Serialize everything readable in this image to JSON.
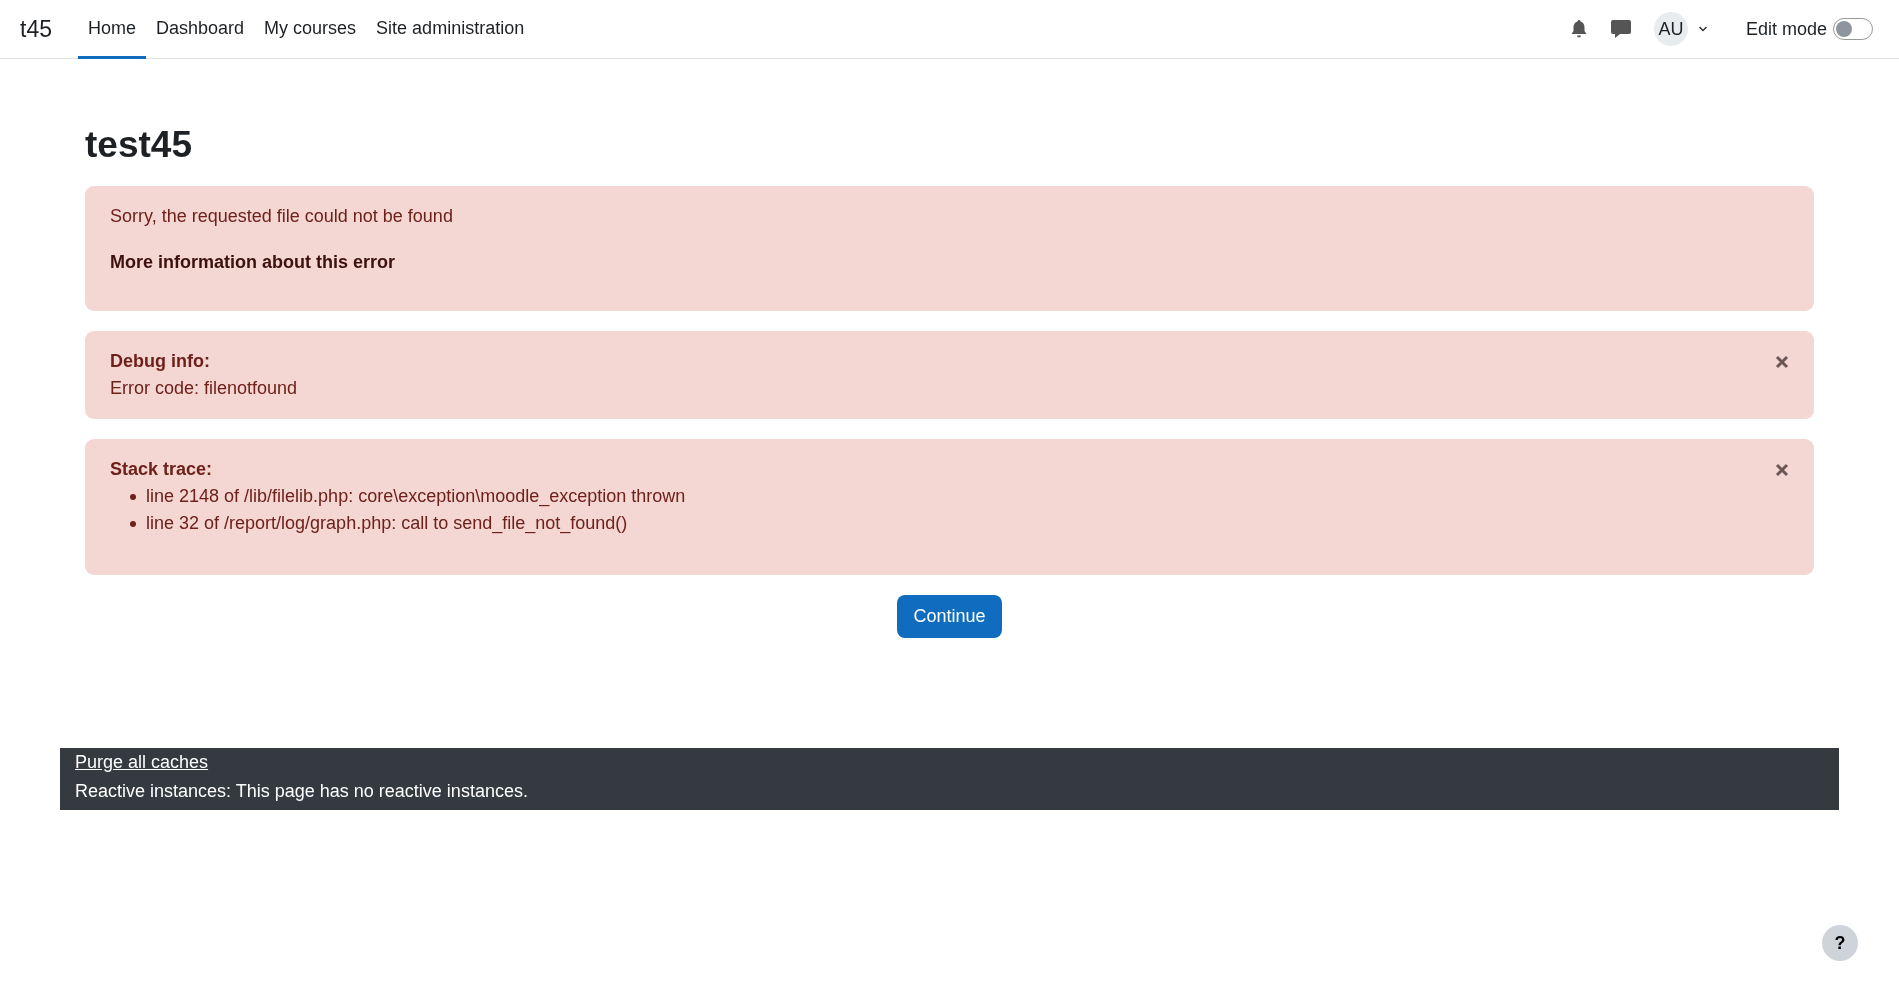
{
  "navbar": {
    "brand": "t45",
    "items": [
      {
        "label": "Home",
        "selected": true
      },
      {
        "label": "Dashboard",
        "selected": false
      },
      {
        "label": "My courses",
        "selected": false
      },
      {
        "label": "Site administration",
        "selected": false
      }
    ],
    "avatar": "AU",
    "edit_mode": {
      "label": "Edit mode",
      "on": false
    }
  },
  "page_title": "test45",
  "error": {
    "message": "Sorry, the requested file could not be found",
    "more_info": "More information about this error"
  },
  "debug": {
    "title": "Debug info:",
    "lines": [
      "Error code: filenotfound"
    ]
  },
  "stack": {
    "title": "Stack trace:",
    "items": [
      "line 2148 of /lib/filelib.php: core\\exception\\moodle_exception thrown",
      "line 32 of /report/log/graph.php: call to send_file_not_found()"
    ]
  },
  "continue_button": "Continue",
  "footer": {
    "link": "Purge all caches",
    "text": "Reactive instances: This page has no reactive instances."
  },
  "help_button": "?"
}
